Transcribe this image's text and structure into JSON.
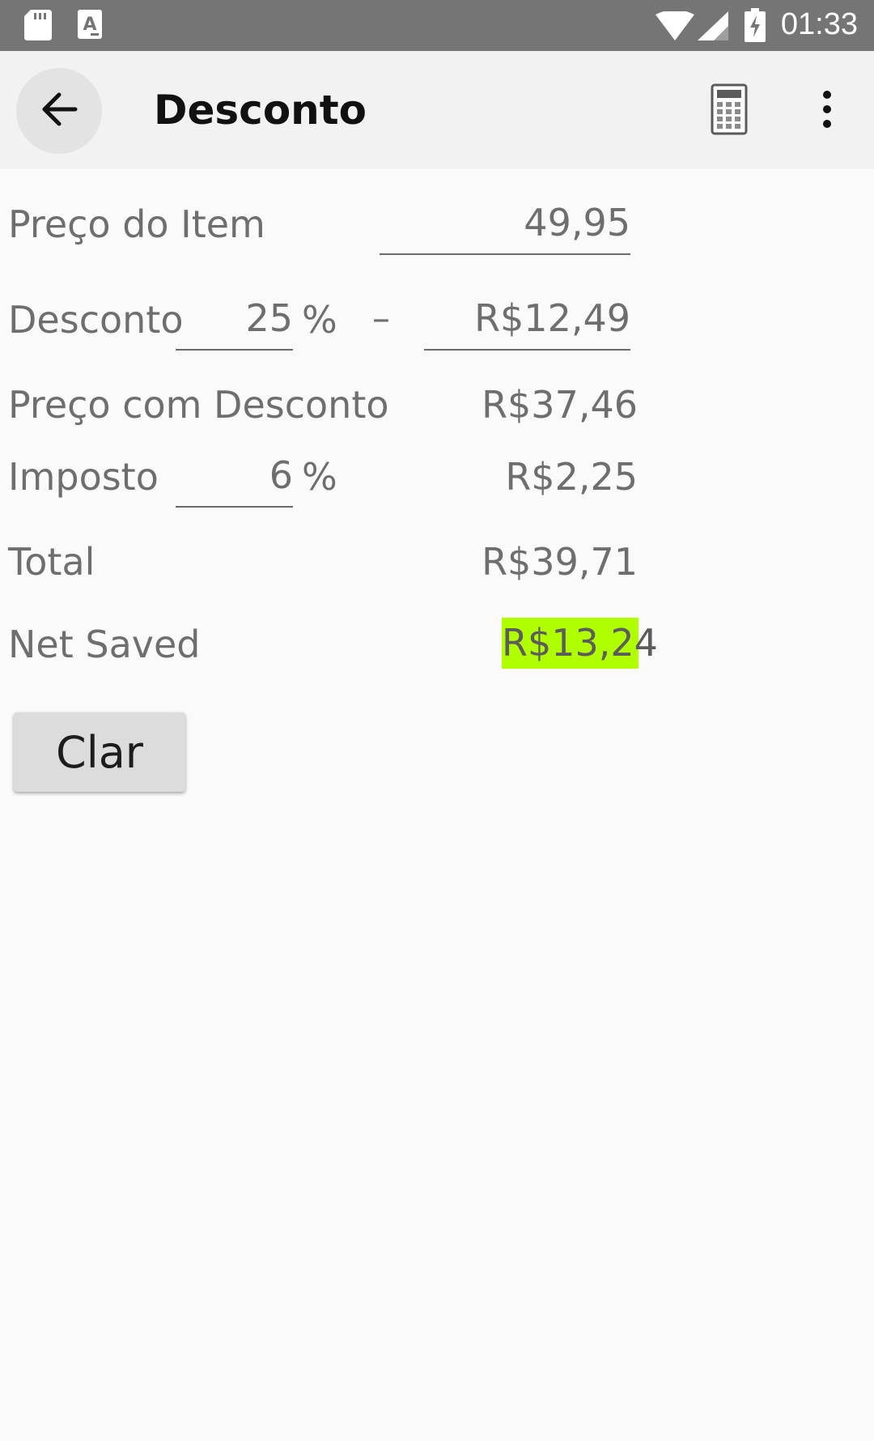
{
  "status_bar": {
    "time": "01:33",
    "icons": [
      "sd-card-icon",
      "text-a-icon",
      "wifi-icon",
      "signal-icon",
      "battery-charging-icon"
    ]
  },
  "app_bar": {
    "title": "Desconto",
    "icons": [
      "back-arrow-icon",
      "calculator-icon",
      "more-vert-icon"
    ]
  },
  "form": {
    "item_price": {
      "label": "Preço do Item",
      "value": "49,95"
    },
    "discount": {
      "label": "Desconto",
      "percent": "25",
      "percent_sign": "%",
      "separator": "–",
      "amount": "R$12,49"
    },
    "discounted_price": {
      "label": "Preço com Desconto",
      "value": "R$37,46"
    },
    "tax": {
      "label": "Imposto",
      "percent": "6",
      "percent_sign": "%",
      "value": "R$2,25"
    },
    "total": {
      "label": "Total",
      "value": "R$39,71"
    },
    "net_saved": {
      "label": "Net Saved",
      "value": "R$13,24",
      "highlight_color": "#b0ff00"
    }
  },
  "clear_button": {
    "label": "Clar"
  }
}
